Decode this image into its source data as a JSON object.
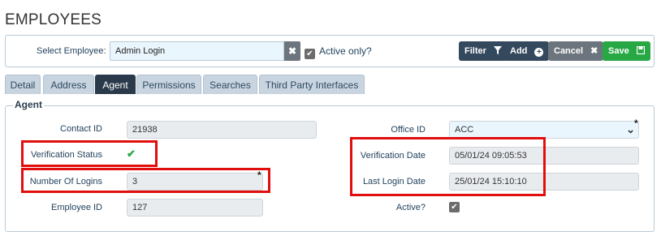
{
  "page": {
    "title": "EMPLOYEES"
  },
  "toolbar": {
    "select_label": "Select Employee:",
    "select_value": "Admin Login",
    "clear_glyph": "✖",
    "active_only_label": "Active only?",
    "active_only_checked": true,
    "filter_label": "Filter",
    "add_label": "Add",
    "cancel_label": "Cancel",
    "save_label": "Save",
    "colors": {
      "dark": "#35495e",
      "grey": "#6c757d",
      "green": "#28a745"
    }
  },
  "tabs": [
    {
      "label": "Detail",
      "active": false
    },
    {
      "label": "Address",
      "active": false
    },
    {
      "label": "Agent",
      "active": true
    },
    {
      "label": "Permissions",
      "active": false
    },
    {
      "label": "Searches",
      "active": false
    },
    {
      "label": "Third Party Interfaces",
      "active": false
    }
  ],
  "agent": {
    "legend": "Agent",
    "contact_id": {
      "label": "Contact ID",
      "value": "21938"
    },
    "verification_status": {
      "label": "Verification Status",
      "verified": true
    },
    "number_of_logins": {
      "label": "Number Of Logins",
      "value": "3",
      "required_mark": "*"
    },
    "employee_id": {
      "label": "Employee ID",
      "value": "127"
    },
    "office_id": {
      "label": "Office ID",
      "value": "ACC",
      "required_mark": "*"
    },
    "verification_date": {
      "label": "Verification Date",
      "value": "05/01/24 09:05:53"
    },
    "last_login_date": {
      "label": "Last Login Date",
      "value": "25/01/24 15:10:10"
    },
    "active": {
      "label": "Active?",
      "checked": true
    }
  },
  "highlight_color": "#e10e0e",
  "icons": [
    "clear-icon",
    "checkbox-icon",
    "filter-icon",
    "plus-circle-icon",
    "times-icon",
    "save-icon",
    "check-icon",
    "chevron-down-icon"
  ]
}
